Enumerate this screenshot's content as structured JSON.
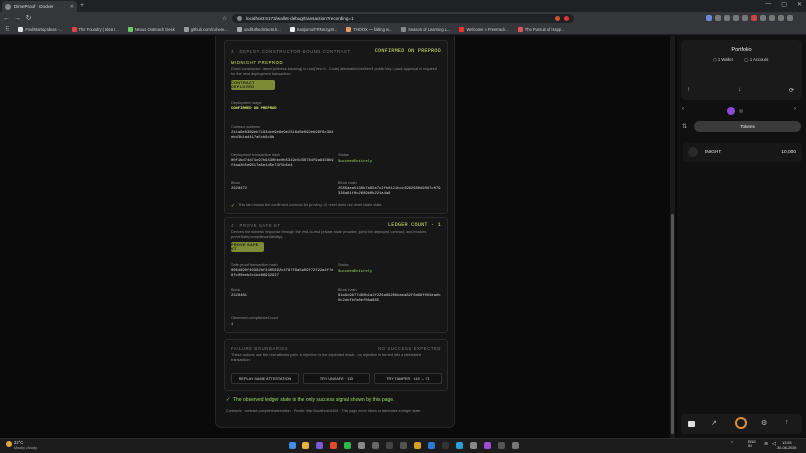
{
  "browser": {
    "tab_title": "DimeProof · Docker",
    "url": "localhost:5173/wallet-debug/transaction?recording=1",
    "bookmarks": [
      "FindStartupIdeas -...",
      "The Foundry | Idea I...",
      "Nexus Outreach Desk",
      "github.com/cohere...",
      "undiluthedrnkets.h...",
      "Sanjurno/FRNIcryptt...",
      "THOOX — falling w...",
      "Season of Learning L...",
      "Welcome » Freetrack...",
      "The Pursuit of Happ..."
    ]
  },
  "step3": {
    "header": "3 · DEPLOY CONSTRUCTOR-BOUND CONTRACT",
    "status": "CONFIRMED ON PREPROD",
    "network": "MIDNIGHT PREPROD",
    "description": "Exact constructor: owner(witness-backing) in root(Yes=0...Code) attestation/verifier/4 public key / pack approval is required for the next deployment transaction.",
    "button": "CONTRACT DEPLOYED",
    "stage_label": "Deployment stage",
    "stage_value": "CONFIRMED ON PREPROD",
    "address_label": "Contract address",
    "address_value": "211a6e0389eb7193dce9e8e9e2316d6e892eb96f6c384ebd3b1ad417a5cb9c8b",
    "tx_label": "Deployment transaction hash",
    "tx_value": "00f1bd74d74c97b9430bbc0b5319c5d36784f9a9438b9f4aa2b5e9517a5e1d5e73f5b5e4",
    "status_label": "Status",
    "status_value": "SucceedEntirely",
    "block_label": "Block",
    "block_value": "2328472",
    "blockhash_label": "Block hash",
    "blockhash_value": "2585aea5138b7a65e7c2fb0121bcc4962680d9087c079336a61f0c2689b0b221a4a6",
    "note": "This tab reuses the confirmed contract for proving. UI reset does not reset chain state."
  },
  "step4": {
    "header": "4 · PROVE SAFE KT",
    "status": "LEDGER COUNT · 1",
    "description": "Derives the witness response through the end-to-end private state provider, joins the deployed contract, and invokes proveSafe(complianceValidity).",
    "button": "PROVE SAFE KT",
    "tx_label": "Safe-proof transaction hash",
    "tx_value": "0064890f40382bf2465892c4787f8a5a09f72f22a4f7e8fc00eeb2c1be88932927",
    "status_label": "Status",
    "status_value": "SucceedEntirely",
    "block_label": "Block",
    "block_value": "2328481",
    "blockhash_label": "Block hash",
    "blockhash_value": "81a9c9877d90b1a1f226a6920bbaea82f0a68f064eaeb0c2ebfbfa0ef0ba685",
    "count_label": "Observed complianceCount",
    "count_value": "1"
  },
  "failure": {
    "header": "FAILURE BOUNDARIES",
    "status": "NO SUCCESS EXPECTED",
    "description": "These actions use the real witness path. A rejection is the expected result - no rejection is turned into a fabricated transaction.",
    "buttons": [
      "REPLAY SAME ATTESTATION",
      "TRY UNSAFE · 115",
      "TRY TAMPER · 115 → 71"
    ]
  },
  "success_note": "The observed ledger state is the only success signal shown by this page.",
  "footer": "Contracts · contract-compiled/attestation · Proofs: http://localhost:6300 · This page never fakes or fabricates a ledger state.",
  "wallet": {
    "title": "Portfolio",
    "wallets": "1 Wallet",
    "accounts": "1 Account",
    "tokens_tab": "Tokens",
    "token_name": "tNIGHT",
    "token_amount": "10,000"
  },
  "taskbar": {
    "temp": "22°C",
    "weather": "Mostly cloudy",
    "lang": "ENG\nIN",
    "time": "13:51",
    "date": "30-08-2026"
  }
}
